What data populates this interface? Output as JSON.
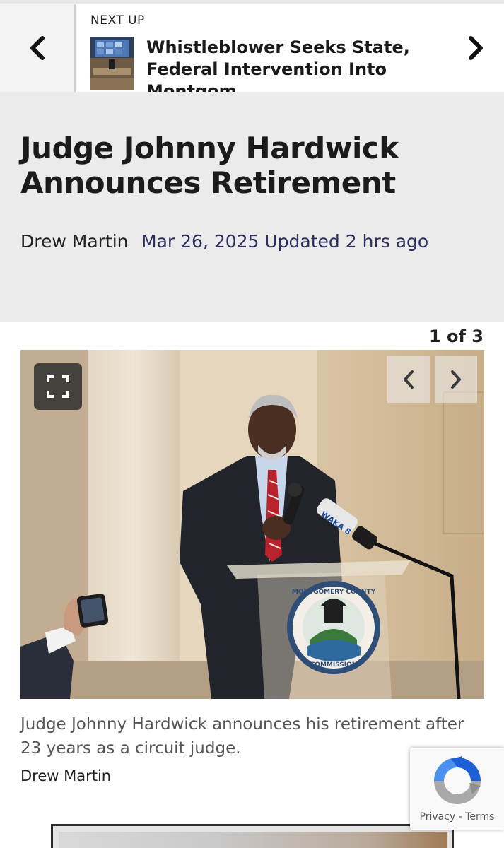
{
  "next_up": {
    "label": "NEXT UP",
    "title": "Whistleblower Seeks State, Federal Intervention Into Montgom..."
  },
  "article": {
    "headline": "Judge Johnny Hardwick Announces Retirement",
    "author": "Drew Martin",
    "date": "Mar 26, 2025 Updated 2 hrs ago"
  },
  "gallery": {
    "counter": "1 of 3",
    "caption": "Judge Johnny Hardwick announces his retirement after 23 years as a circuit judge.",
    "credit": "Drew Martin",
    "podium_seal_top": "MONTGOMERY COUNTY",
    "podium_seal_bottom": "COMMISSION",
    "mic_logo": "WAKA 8"
  },
  "recaptcha": {
    "privacy": "Privacy",
    "separator": " - ",
    "terms": "Terms"
  },
  "colors": {
    "headline_bg": "#ebebeb",
    "date_color": "#2e2e5c",
    "photo_wall": "#d9c7ad"
  }
}
